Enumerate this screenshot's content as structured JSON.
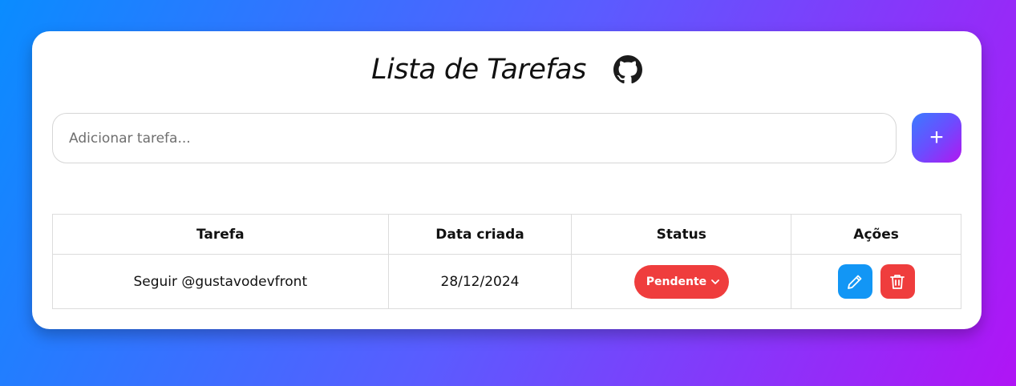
{
  "header": {
    "title": "Lista de Tarefas",
    "github_icon": "github-icon"
  },
  "input": {
    "placeholder": "Adicionar tarefa...",
    "value": "",
    "add_label": "+"
  },
  "table": {
    "headers": [
      "Tarefa",
      "Data criada",
      "Status",
      "Ações"
    ],
    "rows": [
      {
        "task": "Seguir @gustavodevfront",
        "date": "28/12/2024",
        "status": "Pendente",
        "edit_icon": "pencil-icon",
        "delete_icon": "trash-icon"
      }
    ]
  },
  "colors": {
    "accent_blue": "#1296f5",
    "danger_red": "#ef3d3d",
    "gradient_start": "#0a8cff",
    "gradient_end": "#b014f5"
  }
}
